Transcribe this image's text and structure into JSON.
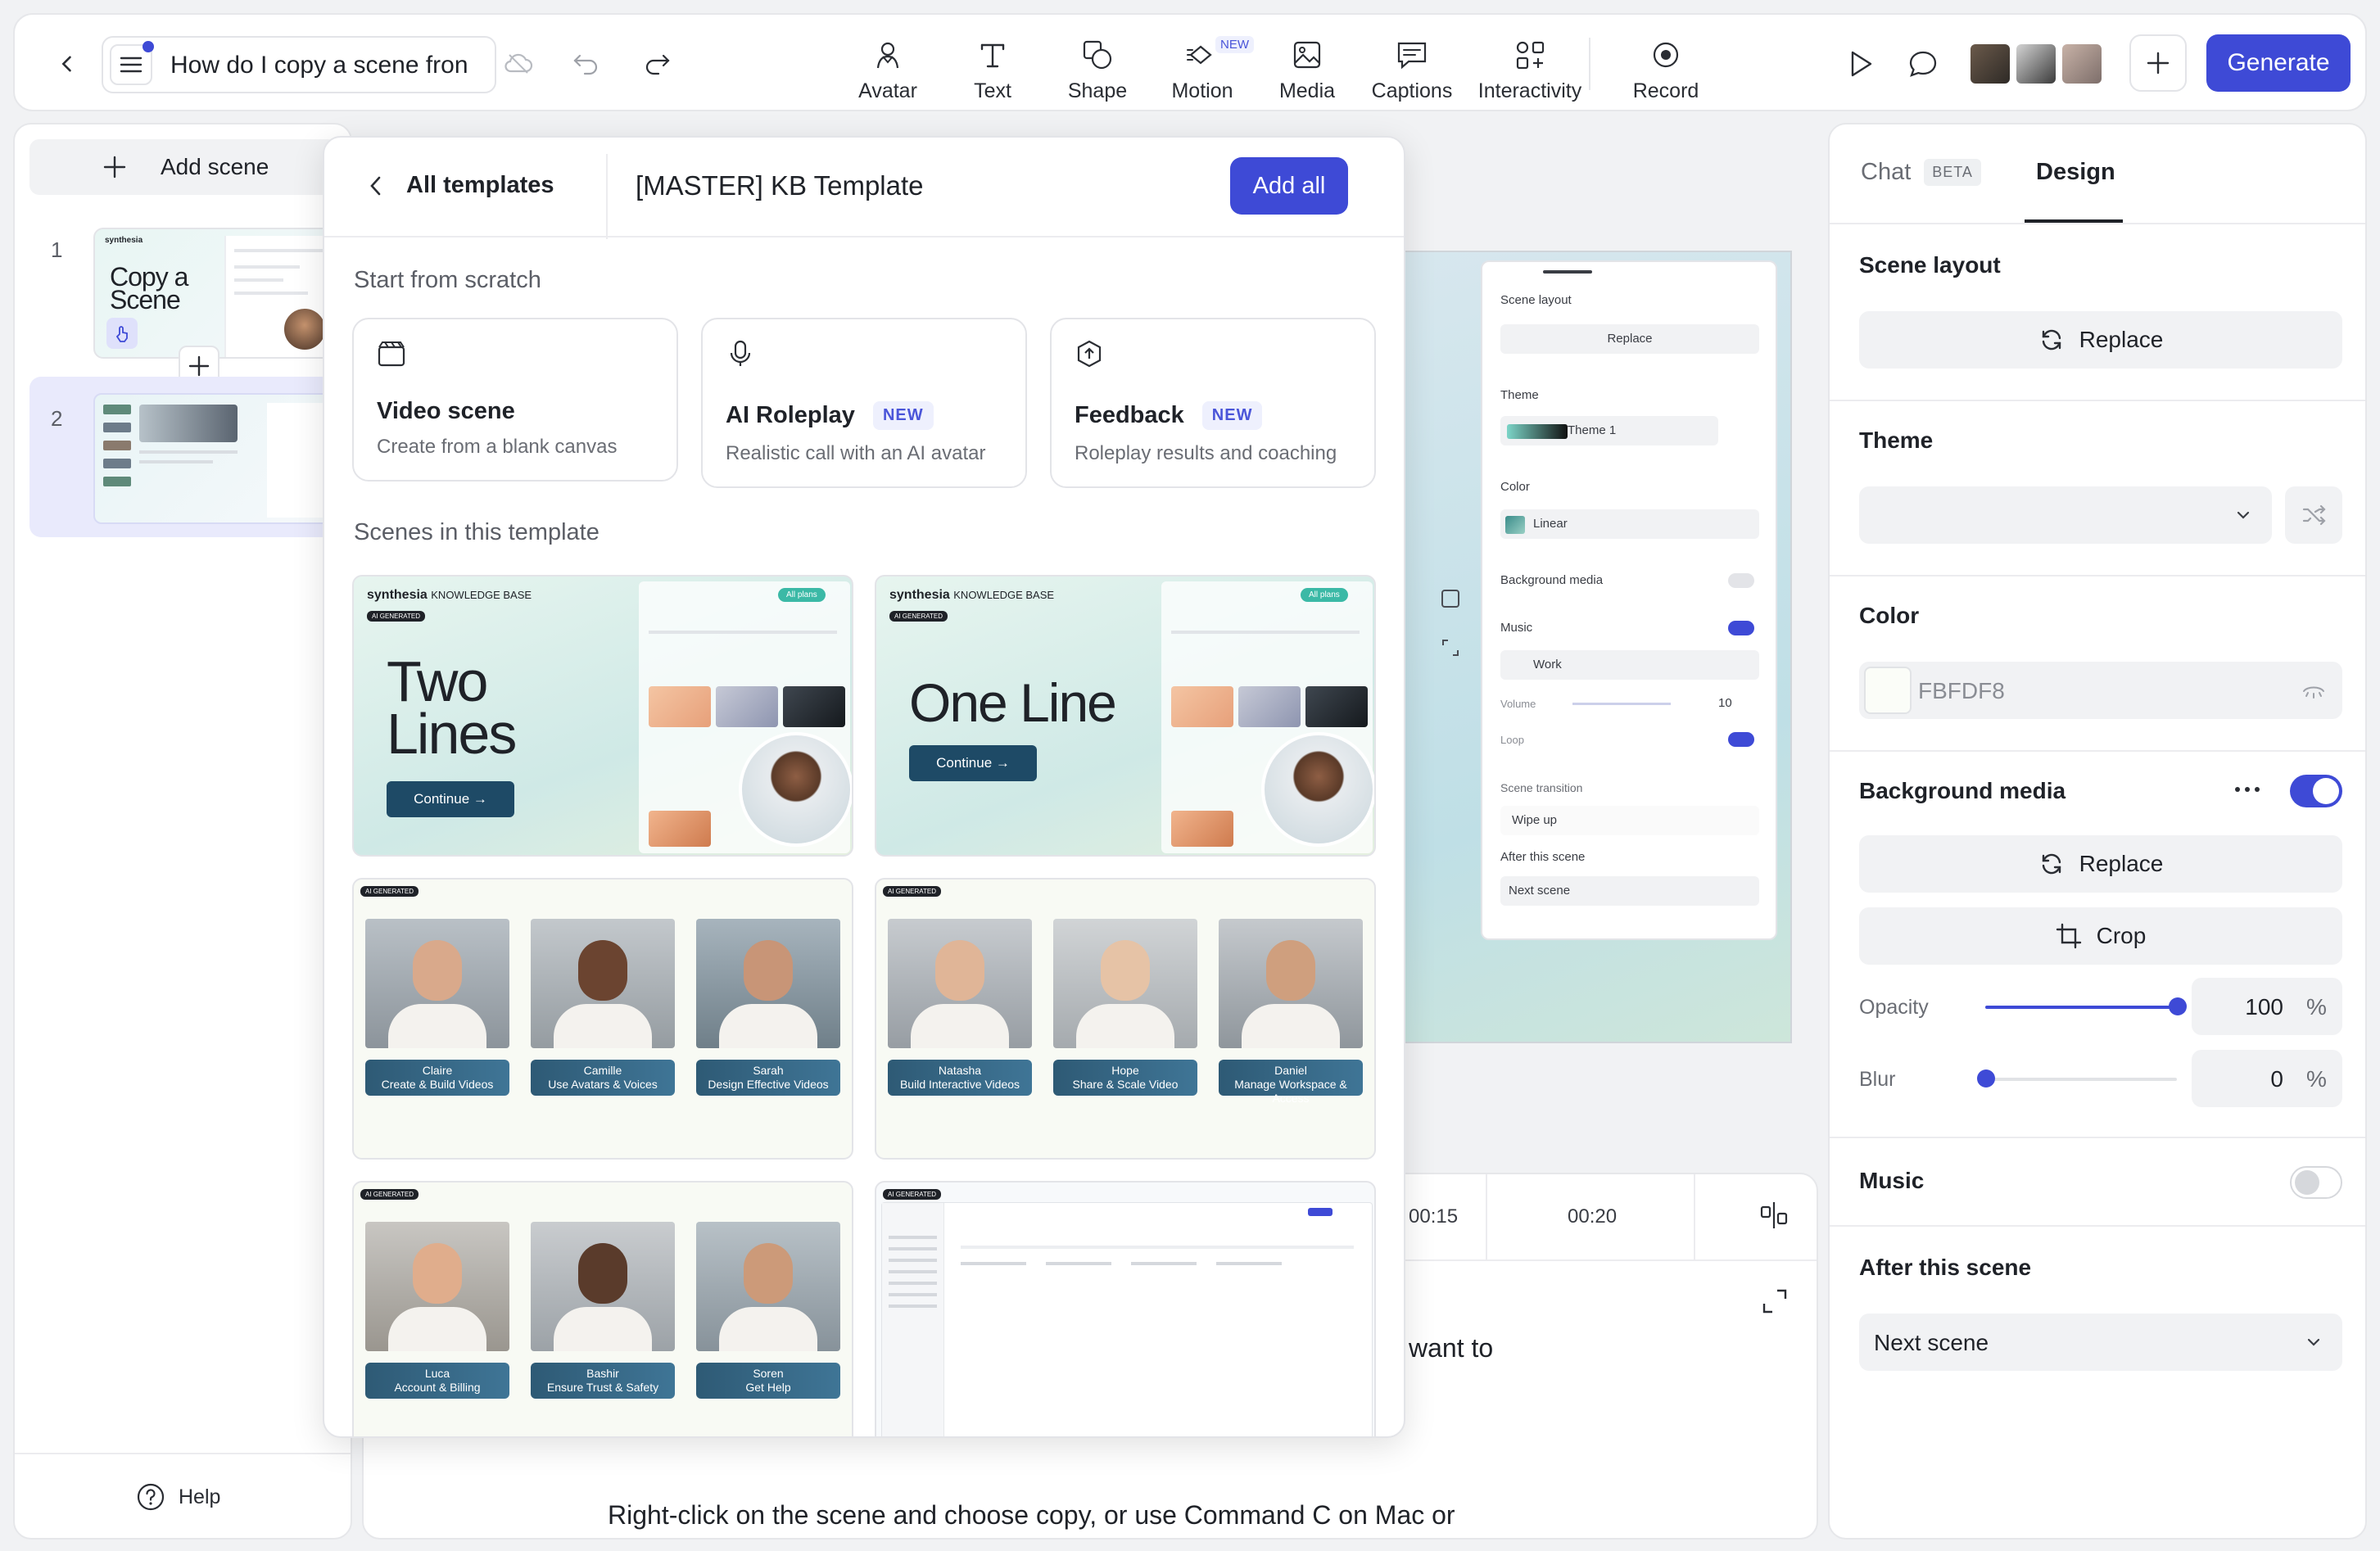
{
  "topbar": {
    "doc_title": "How do I copy a scene fron",
    "tools": [
      {
        "label": "Avatar",
        "icon": "avatar-icon"
      },
      {
        "label": "Text",
        "icon": "text-icon"
      },
      {
        "label": "Shape",
        "icon": "shape-icon"
      },
      {
        "label": "Motion",
        "icon": "motion-icon",
        "badge": "NEW"
      },
      {
        "label": "Media",
        "icon": "media-icon"
      },
      {
        "label": "Captions",
        "icon": "captions-icon"
      },
      {
        "label": "Interactivity",
        "icon": "interactivity-icon"
      },
      {
        "label": "Record",
        "icon": "record-icon"
      }
    ],
    "generate_label": "Generate"
  },
  "left": {
    "add_scene_label": "Add scene",
    "scenes": [
      {
        "number": "1",
        "title_line1": "Copy a",
        "title_line2": "Scene"
      },
      {
        "number": "2"
      }
    ],
    "help_label": "Help"
  },
  "templates": {
    "back_label": "All templates",
    "title": "[MASTER] KB Template",
    "add_all_label": "Add all",
    "scratch_heading": "Start from scratch",
    "scratch_cards": [
      {
        "title": "Video scene",
        "subtitle": "Create from a blank canvas",
        "icon": "clapperboard-icon"
      },
      {
        "title": "AI Roleplay",
        "badge": "NEW",
        "subtitle": "Realistic call with an AI avatar",
        "icon": "microphone-icon"
      },
      {
        "title": "Feedback",
        "badge": "NEW",
        "subtitle": "Roleplay results and coaching",
        "icon": "upload-shield-icon"
      }
    ],
    "scenes_heading": "Scenes in this template",
    "brand": "synthesia",
    "brand_sub": "KNOWLEDGE BASE",
    "ai_tag": "AI GENERATED",
    "all_plans": "All plans",
    "thumb1": {
      "line1": "Two",
      "line2": "Lines",
      "cta": "Continue →"
    },
    "thumb2": {
      "line1": "One Line",
      "cta": "Continue →"
    },
    "people_row1": [
      {
        "name": "Claire",
        "role": "Create & Build Videos"
      },
      {
        "name": "Camille",
        "role": "Use Avatars & Voices"
      },
      {
        "name": "Sarah",
        "role": "Design Effective Videos"
      }
    ],
    "people_row2": [
      {
        "name": "Natasha",
        "role": "Build Interactive Videos"
      },
      {
        "name": "Hope",
        "role": "Share & Scale Video"
      },
      {
        "name": "Daniel",
        "role": "Manage Workspace & Access"
      }
    ],
    "people_row3": [
      {
        "name": "Luca",
        "role": "Account & Billing"
      },
      {
        "name": "Bashir",
        "role": "Ensure Trust & Safety"
      },
      {
        "name": "Soren",
        "role": "Get Help"
      }
    ]
  },
  "canvas_preview": {
    "rows": [
      "Scene layout",
      "Replace",
      "Theme",
      "Theme 1",
      "Color",
      "Linear",
      "Background media",
      "Music",
      "Work",
      "Volume",
      "10",
      "%",
      "Loop",
      "Scene transition",
      "Wipe up",
      "After this scene",
      "Next scene"
    ]
  },
  "timeline": {
    "t1": "00:15",
    "t2": "00:20"
  },
  "script": {
    "partial_text": "want to",
    "bottom_text": "Right-click on the scene and choose copy, or use Command C on Mac or"
  },
  "right": {
    "tab_chat": "Chat",
    "tab_chat_badge": "BETA",
    "tab_design": "Design",
    "scene_layout_title": "Scene layout",
    "replace_label": "Replace",
    "theme_title": "Theme",
    "color_title": "Color",
    "color_value": "FBFDF8",
    "bg_media_title": "Background media",
    "crop_label": "Crop",
    "opacity_label": "Opacity",
    "opacity_value": "100",
    "blur_label": "Blur",
    "blur_value": "0",
    "percent": "%",
    "music_title": "Music",
    "after_scene_title": "After this scene",
    "after_scene_value": "Next scene"
  },
  "colors": {
    "accent": "#3e4ad6",
    "toggle_on": "#3e4ad6"
  }
}
